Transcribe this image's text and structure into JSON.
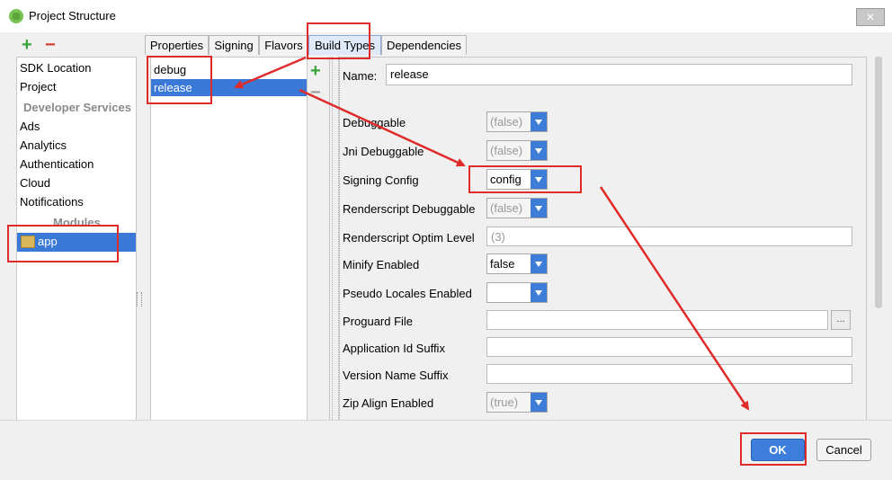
{
  "window": {
    "title": "Project Structure",
    "close_label": "✕"
  },
  "left_toolbar": {
    "add_label": "+",
    "remove_label": "−"
  },
  "left_list": {
    "items": [
      "SDK Location",
      "Project"
    ],
    "developer_services_header": "Developer Services",
    "services": [
      "Ads",
      "Analytics",
      "Authentication",
      "Cloud",
      "Notifications"
    ],
    "modules_header": "Modules",
    "module": "app"
  },
  "tabs": [
    "Properties",
    "Signing",
    "Flavors",
    "Build Types",
    "Dependencies"
  ],
  "active_tab": "Build Types",
  "build_types": {
    "items": [
      "debug",
      "release"
    ],
    "selected": "release",
    "add_label": "+",
    "remove_label": "−"
  },
  "form": {
    "name_label": "Name:",
    "name_value": "release",
    "fields": {
      "debuggable": {
        "label": "Debuggable",
        "value": "(false)"
      },
      "jni_debuggable": {
        "label": "Jni Debuggable",
        "value": "(false)"
      },
      "signing_config": {
        "label": "Signing Config",
        "value": "config"
      },
      "renderscript_debuggable": {
        "label": "Renderscript Debuggable",
        "value": "(false)"
      },
      "renderscript_optim_level": {
        "label": "Renderscript Optim Level",
        "value": "(3)"
      },
      "minify_enabled": {
        "label": "Minify Enabled",
        "value": "false"
      },
      "pseudo_locales_enabled": {
        "label": "Pseudo Locales Enabled",
        "value": ""
      },
      "proguard_file": {
        "label": "Proguard File",
        "value": "",
        "browse_label": "..."
      },
      "application_id_suffix": {
        "label": "Application Id Suffix",
        "value": ""
      },
      "version_name_suffix": {
        "label": "Version Name Suffix",
        "value": ""
      },
      "zip_align_enabled": {
        "label": "Zip Align Enabled",
        "value": "(true)"
      }
    }
  },
  "buttons": {
    "ok": "OK",
    "cancel": "Cancel"
  },
  "colors": {
    "selection": "#3b79d8",
    "annotation": "#e02b2b",
    "add": "#39a33a",
    "remove": "#d13b2e"
  }
}
